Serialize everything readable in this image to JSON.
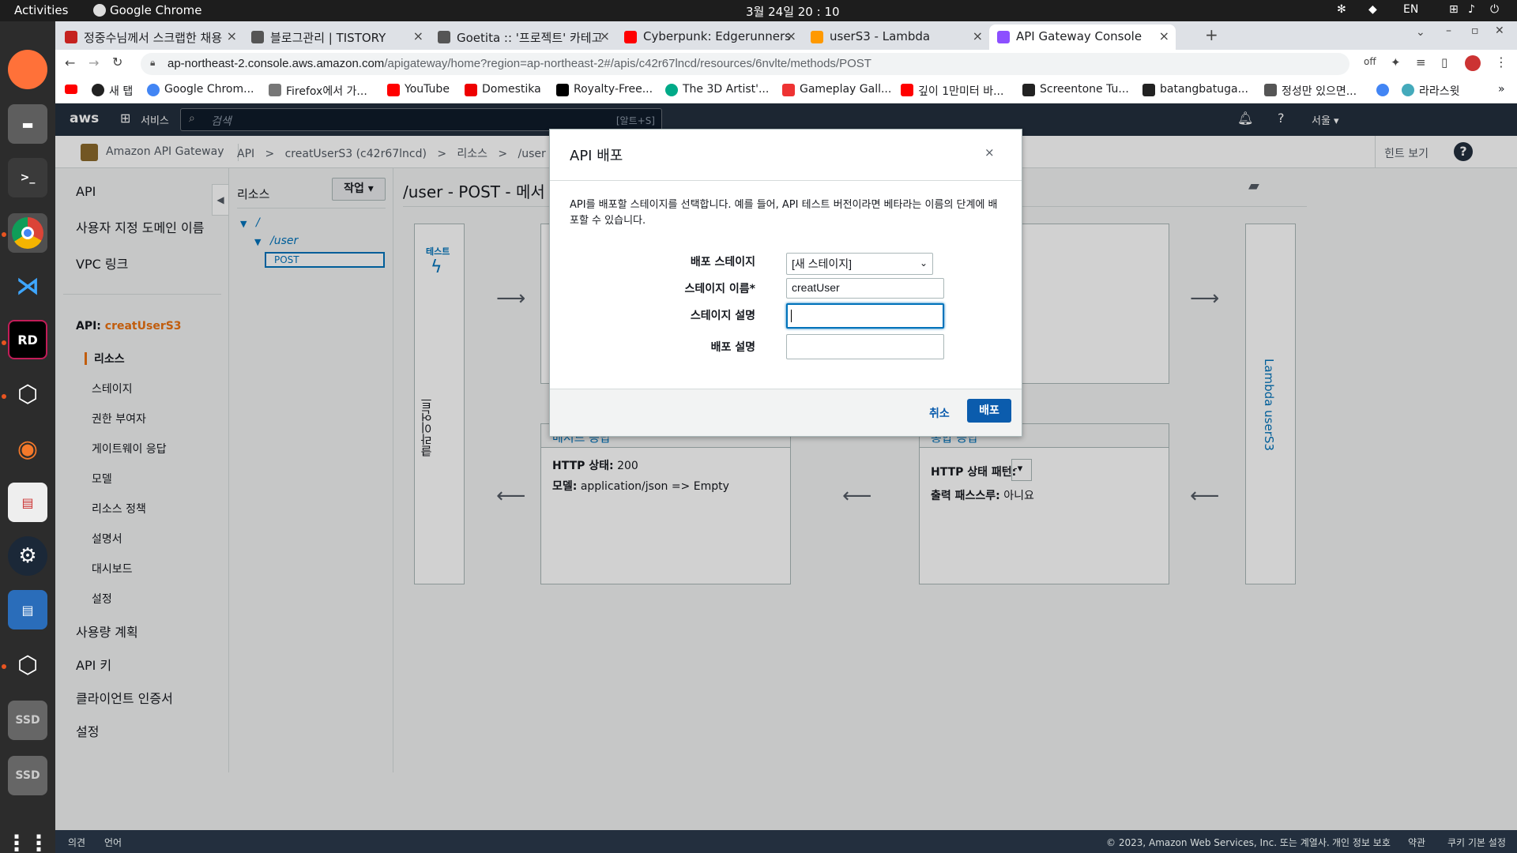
{
  "system": {
    "activities": "Activities",
    "app_name": "Google Chrome",
    "clock": "3월 24일  20 : 10",
    "lang": "EN"
  },
  "tabs": [
    {
      "title": "정중수님께서 스크랩한 채용",
      "color": "#c5221f"
    },
    {
      "title": "블로그관리 | TISTORY",
      "color": "#333"
    },
    {
      "title": "Goetita :: '프로젝트' 카테고",
      "color": "#333"
    },
    {
      "title": "Cyberpunk: Edgerunners",
      "color": "#ff0000"
    },
    {
      "title": "userS3 - Lambda",
      "color": "#ff9900"
    },
    {
      "title": "API Gateway Console",
      "color": "#8c4fff"
    }
  ],
  "url": {
    "host": "ap-northeast-2.console.aws.amazon.com",
    "path": "/apigateway/home?region=ap-northeast-2#/apis/c42r67lncd/resources/6nvlte/methods/POST"
  },
  "bookmarks": [
    "새 탭",
    "Google Chrom...",
    "Firefox에서 가...",
    "YouTube",
    "Domestika",
    "Royalty-Free...",
    "The 3D Artist'...",
    "Gameplay Gall...",
    "깊이 1만미터 바...",
    "Screentone Tu...",
    "batangbatuga...",
    "정성만 있으면...",
    "라라스윗"
  ],
  "aws": {
    "logo": "aws",
    "services": "서비스",
    "search_placeholder": "검색",
    "search_shortcut": "[알트+S]",
    "region": "서울 ▾"
  },
  "subnav": {
    "product": "Amazon API Gateway",
    "crumbs": [
      "API",
      ">",
      "creatUserS3 (c42r67lncd)",
      ">",
      "리소스",
      ">",
      "/user (6nv"
    ],
    "hint": "힌트 보기"
  },
  "leftnav": {
    "top": [
      "API",
      "사용자 지정 도메인 이름",
      "VPC 링크"
    ],
    "api_label": "API:",
    "api_name": "creatUserS3",
    "sub": [
      "리소스",
      "스테이지",
      "권한 부여자",
      "게이트웨이 응답",
      "모델",
      "리소스 정책",
      "설명서",
      "대시보드",
      "설정"
    ],
    "bottom": [
      "사용량 계획",
      "API 키",
      "클라이언트 인증서",
      "설정"
    ]
  },
  "resources": {
    "title": "리소스",
    "action": "작업 ▾",
    "root": "/",
    "user": "/user",
    "method": "POST"
  },
  "main": {
    "title": "/user - POST - 메서",
    "test_label": "테스트",
    "client_label": "클라이언트",
    "lambda_label": "Lambda userS3",
    "fragment": "2",
    "method_response": {
      "header": "메서드 응답",
      "status_label": "HTTP 상태:",
      "status_value": "200",
      "model_label": "모델:",
      "model_value": "application/json => Empty"
    },
    "integration_response": {
      "header": "통합 응답",
      "pattern_label": "HTTP 상태 패턴:",
      "pattern_value": "-",
      "passthrough_label": "출력 패스스루:",
      "passthrough_value": "아니요"
    }
  },
  "modal": {
    "title": "API 배포",
    "close": "×",
    "description": "API를 배포할 스테이지를 선택합니다. 예를 들어, API 테스트 버전이라면 베타라는 이름의 단계에 배포할 수 있습니다.",
    "stage_label": "배포 스테이지",
    "stage_value": "[새 스테이지]",
    "stage_name_label": "스테이지 이름*",
    "stage_name_value": "creatUser",
    "stage_desc_label": "스테이지 설명",
    "stage_desc_value": "",
    "deploy_desc_label": "배포 설명",
    "deploy_desc_value": "",
    "cancel": "취소",
    "deploy": "배포"
  },
  "footer": {
    "feedback": "의견",
    "language": "언어",
    "copyright": "© 2023, Amazon Web Services, Inc. 또는 계열사.",
    "privacy": "개인 정보 보호",
    "terms": "약관",
    "cookies": "쿠키 기본 설정"
  },
  "colors": {
    "aws_dark": "#232f3e",
    "aws_orange": "#ec7211",
    "link": "#0073bb",
    "primary": "#0b5cad"
  }
}
